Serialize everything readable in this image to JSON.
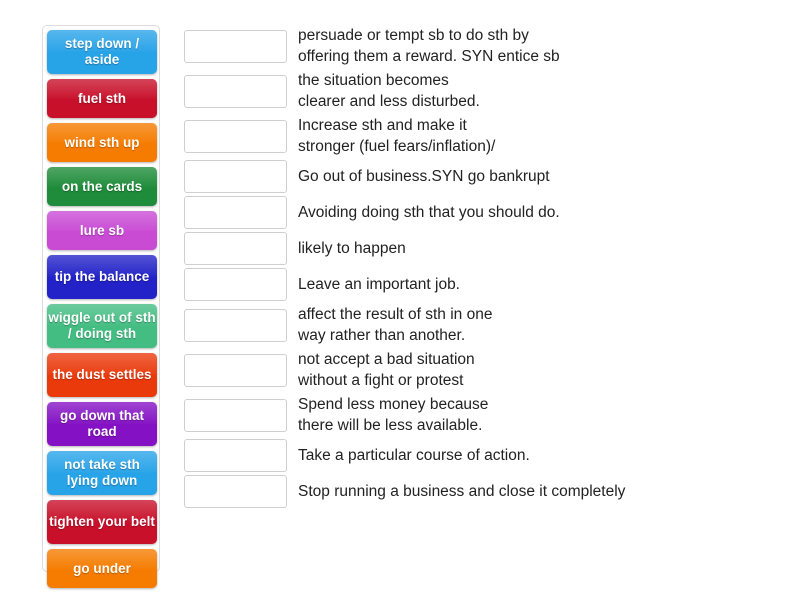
{
  "activity": {
    "type": "match-up",
    "tile_count": 12,
    "dropzone_count": 12
  },
  "tiles": [
    {
      "label": "step down\n/ aside",
      "color": "#27a3e8",
      "lines": 2
    },
    {
      "label": "fuel sth",
      "color": "#c8102a",
      "lines": 1
    },
    {
      "label": "wind sth up",
      "color": "#f57c00",
      "lines": 1
    },
    {
      "label": "on the cards",
      "color": "#1e8c3a",
      "lines": 1
    },
    {
      "label": "lure sb",
      "color": "#c94bd4",
      "lines": 1
    },
    {
      "label": "tip the\nbalance",
      "color": "#2222c8",
      "lines": 2
    },
    {
      "label": "wiggle out of\nsth / doing sth",
      "color": "#43bd82",
      "lines": 2
    },
    {
      "label": "the dust\nsettles",
      "color": "#ea3a0c",
      "lines": 2
    },
    {
      "label": "go down\nthat road",
      "color": "#8411c4",
      "lines": 2
    },
    {
      "label": "not take sth\nlying down",
      "color": "#27a3e8",
      "lines": 2
    },
    {
      "label": "tighten\nyour belt",
      "color": "#c8102a",
      "lines": 2
    },
    {
      "label": "go under",
      "color": "#f57c00",
      "lines": 1
    }
  ],
  "rows": [
    {
      "dropzone_value": "",
      "definition": "persuade or tempt sb to do sth by\noffering them a reward. SYN entice sb"
    },
    {
      "dropzone_value": "",
      "definition": "the situation becomes\nclearer and less disturbed."
    },
    {
      "dropzone_value": "",
      "definition": "Increase sth and make it\nstronger (fuel fears/inflation)/"
    },
    {
      "dropzone_value": "",
      "definition": "Go out of business.SYN go bankrupt"
    },
    {
      "dropzone_value": "",
      "definition": "Avoiding doing sth that you should do."
    },
    {
      "dropzone_value": "",
      "definition": "likely to happen"
    },
    {
      "dropzone_value": "",
      "definition": "Leave an important job."
    },
    {
      "dropzone_value": "",
      "definition": "affect the result of sth in one\nway rather than another."
    },
    {
      "dropzone_value": "",
      "definition": "not accept a bad situation\nwithout a fight or protest"
    },
    {
      "dropzone_value": "",
      "definition": "Spend less money because\nthere will be less available."
    },
    {
      "dropzone_value": "",
      "definition": "Take a particular course of action."
    },
    {
      "dropzone_value": "",
      "definition": "Stop running a business and close it completely"
    }
  ],
  "colors": {
    "page_background": "#ffffff",
    "tray_border": "#dcdcdc",
    "dropzone_border": "#cfcfcf",
    "definition_text": "#222222",
    "tile_text": "#ffffff"
  }
}
